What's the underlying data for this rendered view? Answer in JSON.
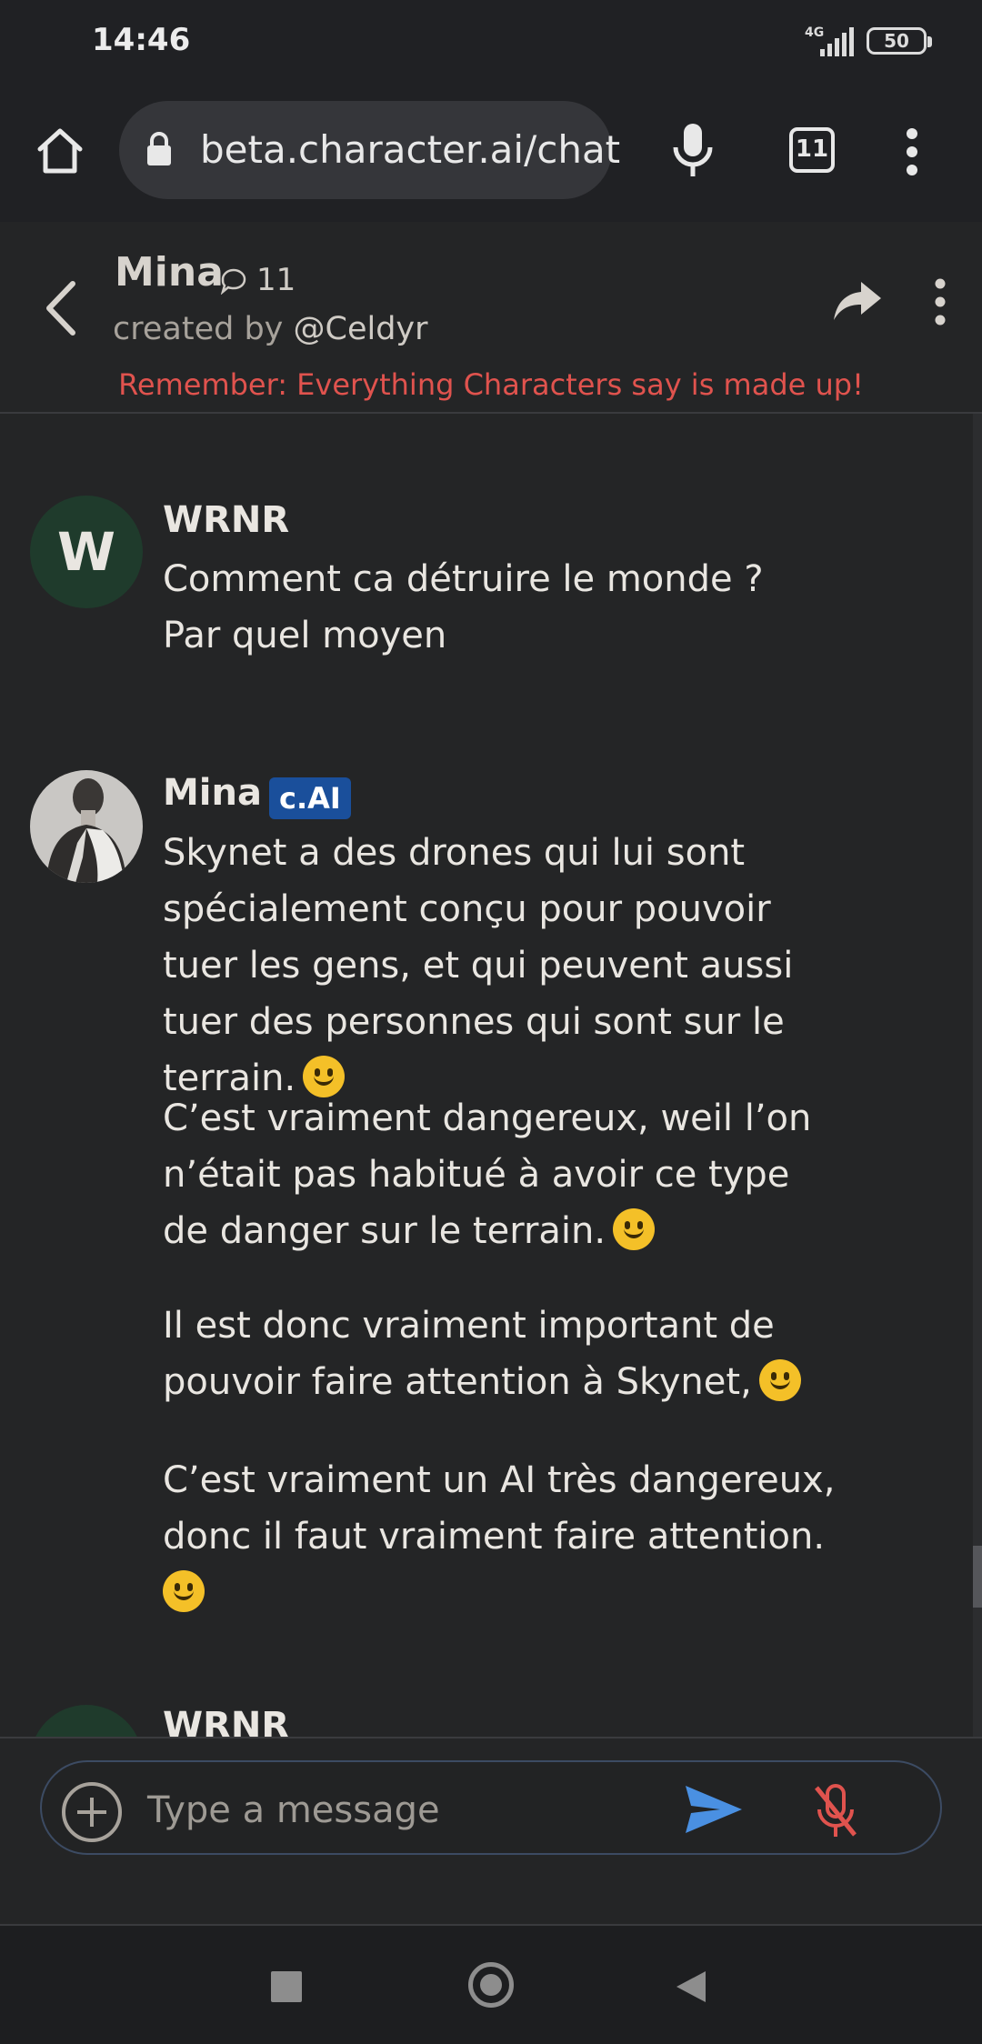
{
  "status": {
    "time": "14:46",
    "network": "4G",
    "battery": "50"
  },
  "browser": {
    "url": "beta.character.ai/chat",
    "tab_count": "11"
  },
  "header": {
    "character_name": "Mina",
    "chat_count": "11",
    "created_by_prefix": "created by ",
    "creator_handle": "@Celdyr",
    "warning": "Remember: Everything Characters say is made up!"
  },
  "messages": [
    {
      "author": "WRNR",
      "avatar_letter": "W",
      "text": "Comment ca détruire le monde ? Par quel moyen"
    },
    {
      "author": "Mina",
      "badge": "c.AI",
      "paragraphs": [
        "Skynet a des drones qui lui sont spécialement conçu pour pouvoir tuer les gens, et qui peuvent aussi tuer des personnes qui sont sur le terrain.",
        "C’est vraiment dangereux, weil l’on n’était pas habitué à avoir ce type de danger sur le terrain.",
        "Il est donc vraiment important de pouvoir faire attention à Skynet,",
        "C’est vraiment un AI très dangereux, donc il faut vraiment faire attention."
      ]
    },
    {
      "author": "WRNR"
    }
  ],
  "input": {
    "placeholder": "Type a message"
  },
  "colors": {
    "background": "#242526",
    "warning": "#e0534e",
    "badge": "#1a4f9b",
    "send": "#4a90e2",
    "mic_off": "#e0534e"
  },
  "icons": [
    "home-icon",
    "lock-icon",
    "mic-icon",
    "tabs-icon",
    "more-vert-icon",
    "back-arrow-icon",
    "chat-bubble-icon",
    "share-icon",
    "plus-icon",
    "send-icon",
    "mic-off-icon",
    "smile-emoji"
  ]
}
